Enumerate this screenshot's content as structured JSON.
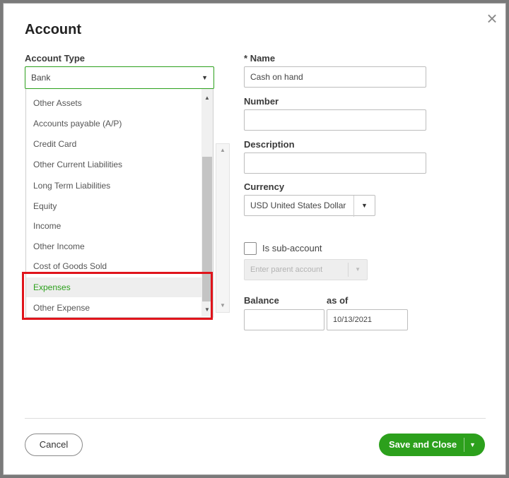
{
  "dialog": {
    "title": "Account",
    "close_icon": "close-icon"
  },
  "account_type": {
    "label": "Account Type",
    "selected": "Bank",
    "options": [
      "Other Assets",
      "Accounts payable (A/P)",
      "Credit Card",
      "Other Current Liabilities",
      "Long Term Liabilities",
      "Equity",
      "Income",
      "Other Income",
      "Cost of Goods Sold",
      "Expenses",
      "Other Expense"
    ],
    "highlighted": "Expenses"
  },
  "name": {
    "label": "Name",
    "required_marker": "*",
    "value": "Cash on hand"
  },
  "number": {
    "label": "Number",
    "value": ""
  },
  "description": {
    "label": "Description",
    "value": ""
  },
  "currency": {
    "label": "Currency",
    "value": "USD United States Dollar"
  },
  "sub_account": {
    "label": "Is sub-account",
    "checked": false,
    "parent_placeholder": "Enter parent account"
  },
  "balance": {
    "label": "Balance",
    "value": "",
    "as_of_label": "as of",
    "as_of_value": "10/13/2021"
  },
  "footer": {
    "cancel_label": "Cancel",
    "save_label": "Save and Close"
  },
  "colors": {
    "accent": "#2ca01c",
    "highlight_box": "#e0141b"
  }
}
